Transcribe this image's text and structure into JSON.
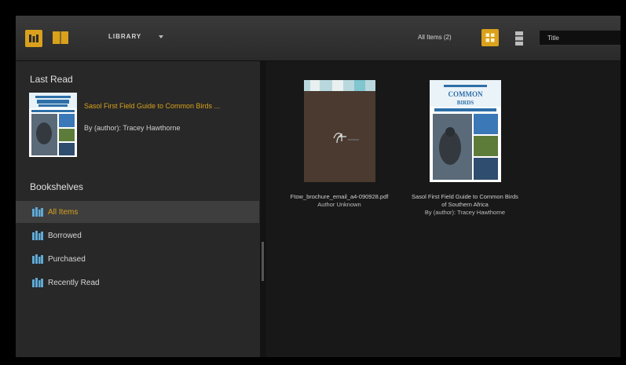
{
  "toolbar": {
    "library_label": "LIBRARY",
    "item_count": "All Items (2)",
    "sort_value": "Title"
  },
  "sidebar": {
    "last_read_heading": "Last Read",
    "last_read_book": {
      "title": "Sasol First Field Guide to Common Birds ...",
      "author": "By (author): Tracey Hawthorne"
    },
    "bookshelves_heading": "Bookshelves",
    "shelves": [
      {
        "label": "All Items",
        "active": true
      },
      {
        "label": "Borrowed",
        "active": false
      },
      {
        "label": "Purchased",
        "active": false
      },
      {
        "label": "Recently Read",
        "active": false
      }
    ]
  },
  "books": [
    {
      "title": "Ftow_brochure_email_a4-090928.pdf",
      "author": "Author Unknown",
      "cover_logo": "ftow"
    },
    {
      "title": "Sasol First Field Guide to Common Birds of Southern Africa",
      "author": "By (author): Tracey Hawthorne",
      "cover_heading": "COMMON BIRDS"
    }
  ],
  "colors": {
    "accent": "#d9a11c",
    "background": "#181818",
    "sidebar": "#282828",
    "toolbar": "#333333"
  },
  "icons": {
    "shelf_view": "bookshelf-icon",
    "reading_view": "open-book-icon",
    "grid_view": "grid-icon",
    "list_view": "list-icon",
    "shelf_item": "books-icon"
  }
}
